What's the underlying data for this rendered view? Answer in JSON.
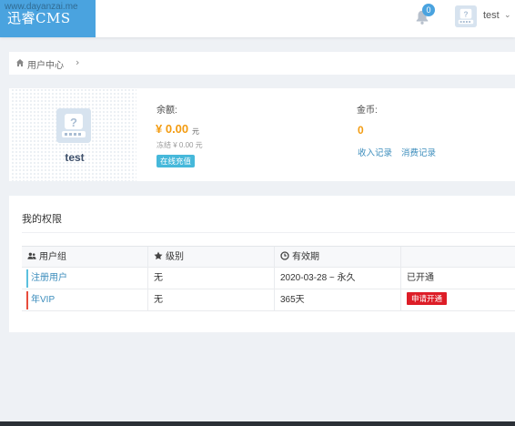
{
  "header": {
    "logo_text": "迅睿CMS",
    "watermark": "www.dayanzai.me",
    "notification_count": "0",
    "username": "test"
  },
  "breadcrumb": {
    "label": "用户中心",
    "separator": "›"
  },
  "profile": {
    "name": "test",
    "balance_label": "余额:",
    "balance_amount": "¥ 0.00",
    "balance_unit": "元",
    "frozen_text": "冻结 ¥ 0.00 元",
    "recharge_label": "在线充值",
    "coin_label": "金币:",
    "coin_amount": "0",
    "income_link": "收入记录",
    "spend_link": "消费记录"
  },
  "permissions": {
    "title": "我的权限",
    "columns": [
      "用户组",
      "级别",
      "有效期",
      ""
    ],
    "rows": [
      {
        "group": "注册用户",
        "level": "无",
        "validity": "2020-03-28 ~ 永久",
        "status": "已开通"
      },
      {
        "group": "年VIP",
        "level": "无",
        "validity": "365天",
        "action": "申请开通"
      }
    ]
  },
  "colors": {
    "accent": "#4aa3df",
    "amount": "#f39c12",
    "link": "#3c8dbc",
    "danger": "#dd1d27",
    "info": "#46b8da"
  },
  "icons": {
    "notification": "bell-icon",
    "breadcrumb": "home-icon",
    "avatar": "default-avatar-icon",
    "col_group": "users-icon",
    "col_level": "star-icon",
    "col_validity": "clock-icon"
  }
}
